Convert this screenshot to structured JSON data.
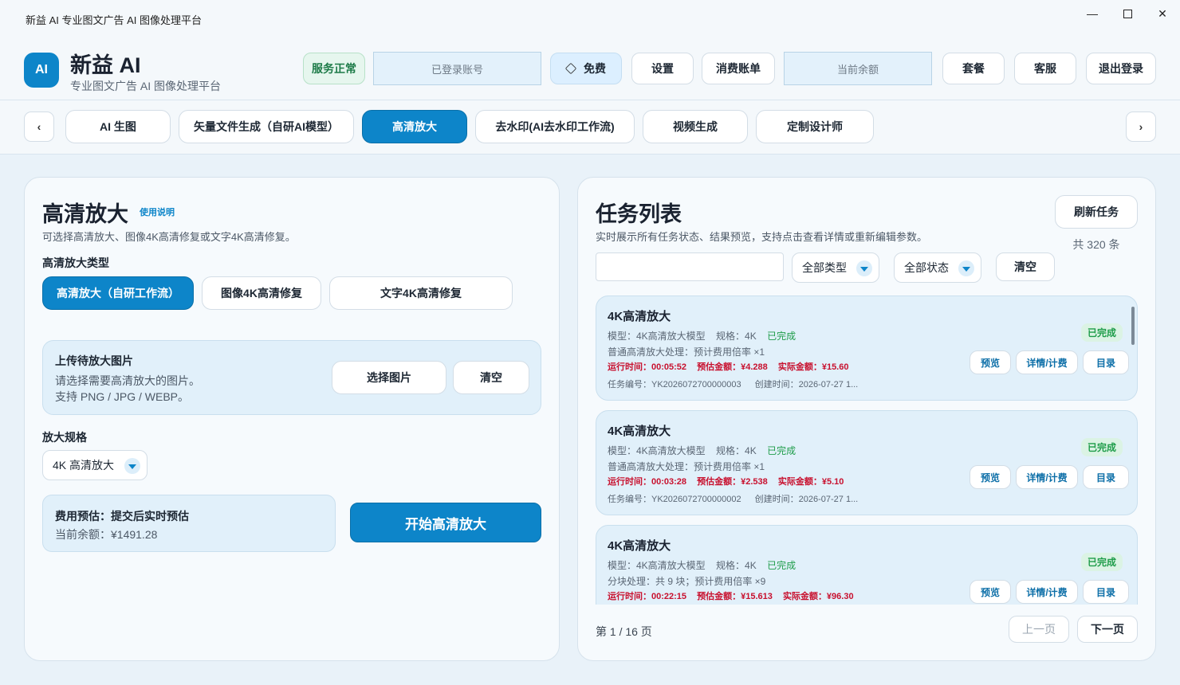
{
  "window": {
    "title": "新益 AI  专业图文广告 AI 图像处理平台",
    "min_glyph": "—",
    "close_glyph": "✕"
  },
  "header": {
    "logo_text": "AI",
    "brand": "新益 AI",
    "subtitle": "专业图文广告 AI 图像处理平台",
    "status": "服务正常",
    "account_placeholder": "已登录账号",
    "free": "免费",
    "settings": "设置",
    "billing": "消费账单",
    "balance_placeholder": "当前余额",
    "plans": "套餐",
    "support": "客服",
    "logout": "退出登录"
  },
  "tabs": {
    "prev": "‹",
    "next": "›",
    "items": [
      "AI 生图",
      "矢量文件生成（自研AI模型）",
      "高清放大",
      "去水印(AI去水印工作流)",
      "视频生成",
      "定制设计师"
    ],
    "active": "高清放大"
  },
  "left": {
    "title": "高清放大",
    "help": "使用说明",
    "desc": "可选择高清放大、图像4K高清修复或文字4K高清修复。",
    "type_label": "高清放大类型",
    "types": [
      "高清放大（自研工作流）",
      "图像4K高清修复",
      "文字4K高清修复"
    ],
    "upload": {
      "title": "上传待放大图片",
      "line1": "请选择需要高清放大的图片。",
      "line2": "支持 PNG / JPG / WEBP。",
      "choose": "选择图片",
      "clear": "清空"
    },
    "spec_label": "放大规格",
    "spec_value": "4K 高清放大",
    "cost": {
      "title": "费用预估：提交后实时预估",
      "balance": "当前余额：¥1491.28"
    },
    "start": "开始高清放大"
  },
  "right": {
    "title": "任务列表",
    "desc": "实时展示所有任务状态、结果预览，支持点击查看详情或重新编辑参数。",
    "refresh": "刷新任务",
    "count": "共 320 条",
    "search_value": "",
    "type_filter": "全部类型",
    "status_filter": "全部状态",
    "clear": "清空",
    "tasks": [
      {
        "title": "4K高清放大",
        "model": "模型：4K高清放大模型",
        "spec": "规格：4K",
        "status": "已完成",
        "process": "普通高清放大处理：预计费用倍率 ×1",
        "runtime": "运行时间：00:05:52",
        "estimate": "预估金额：¥4.288",
        "actual": "实际金额：¥15.60",
        "id": "任务编号：YK2026072700000003",
        "created": "创建时间：2026-07-27 1...",
        "badge": "已完成"
      },
      {
        "title": "4K高清放大",
        "model": "模型：4K高清放大模型",
        "spec": "规格：4K",
        "status": "已完成",
        "process": "普通高清放大处理：预计费用倍率 ×1",
        "runtime": "运行时间：00:03:28",
        "estimate": "预估金额：¥2.538",
        "actual": "实际金额：¥5.10",
        "id": "任务编号：YK2026072700000002",
        "created": "创建时间：2026-07-27 1...",
        "badge": "已完成"
      },
      {
        "title": "4K高清放大",
        "model": "模型：4K高清放大模型",
        "spec": "规格：4K",
        "status": "已完成",
        "process": "分块处理：共 9 块；预计费用倍率 ×9",
        "runtime": "运行时间：00:22:15",
        "estimate": "预估金额：¥15.613",
        "actual": "实际金额：¥96.30",
        "id": "",
        "created": "",
        "badge": "已完成"
      }
    ],
    "card_buttons": {
      "preview": "预览",
      "detail": "详情/计费",
      "folder": "目录"
    },
    "pagination": {
      "info": "第 1 / 16 页",
      "prev": "上一页",
      "next": "下一页"
    }
  }
}
